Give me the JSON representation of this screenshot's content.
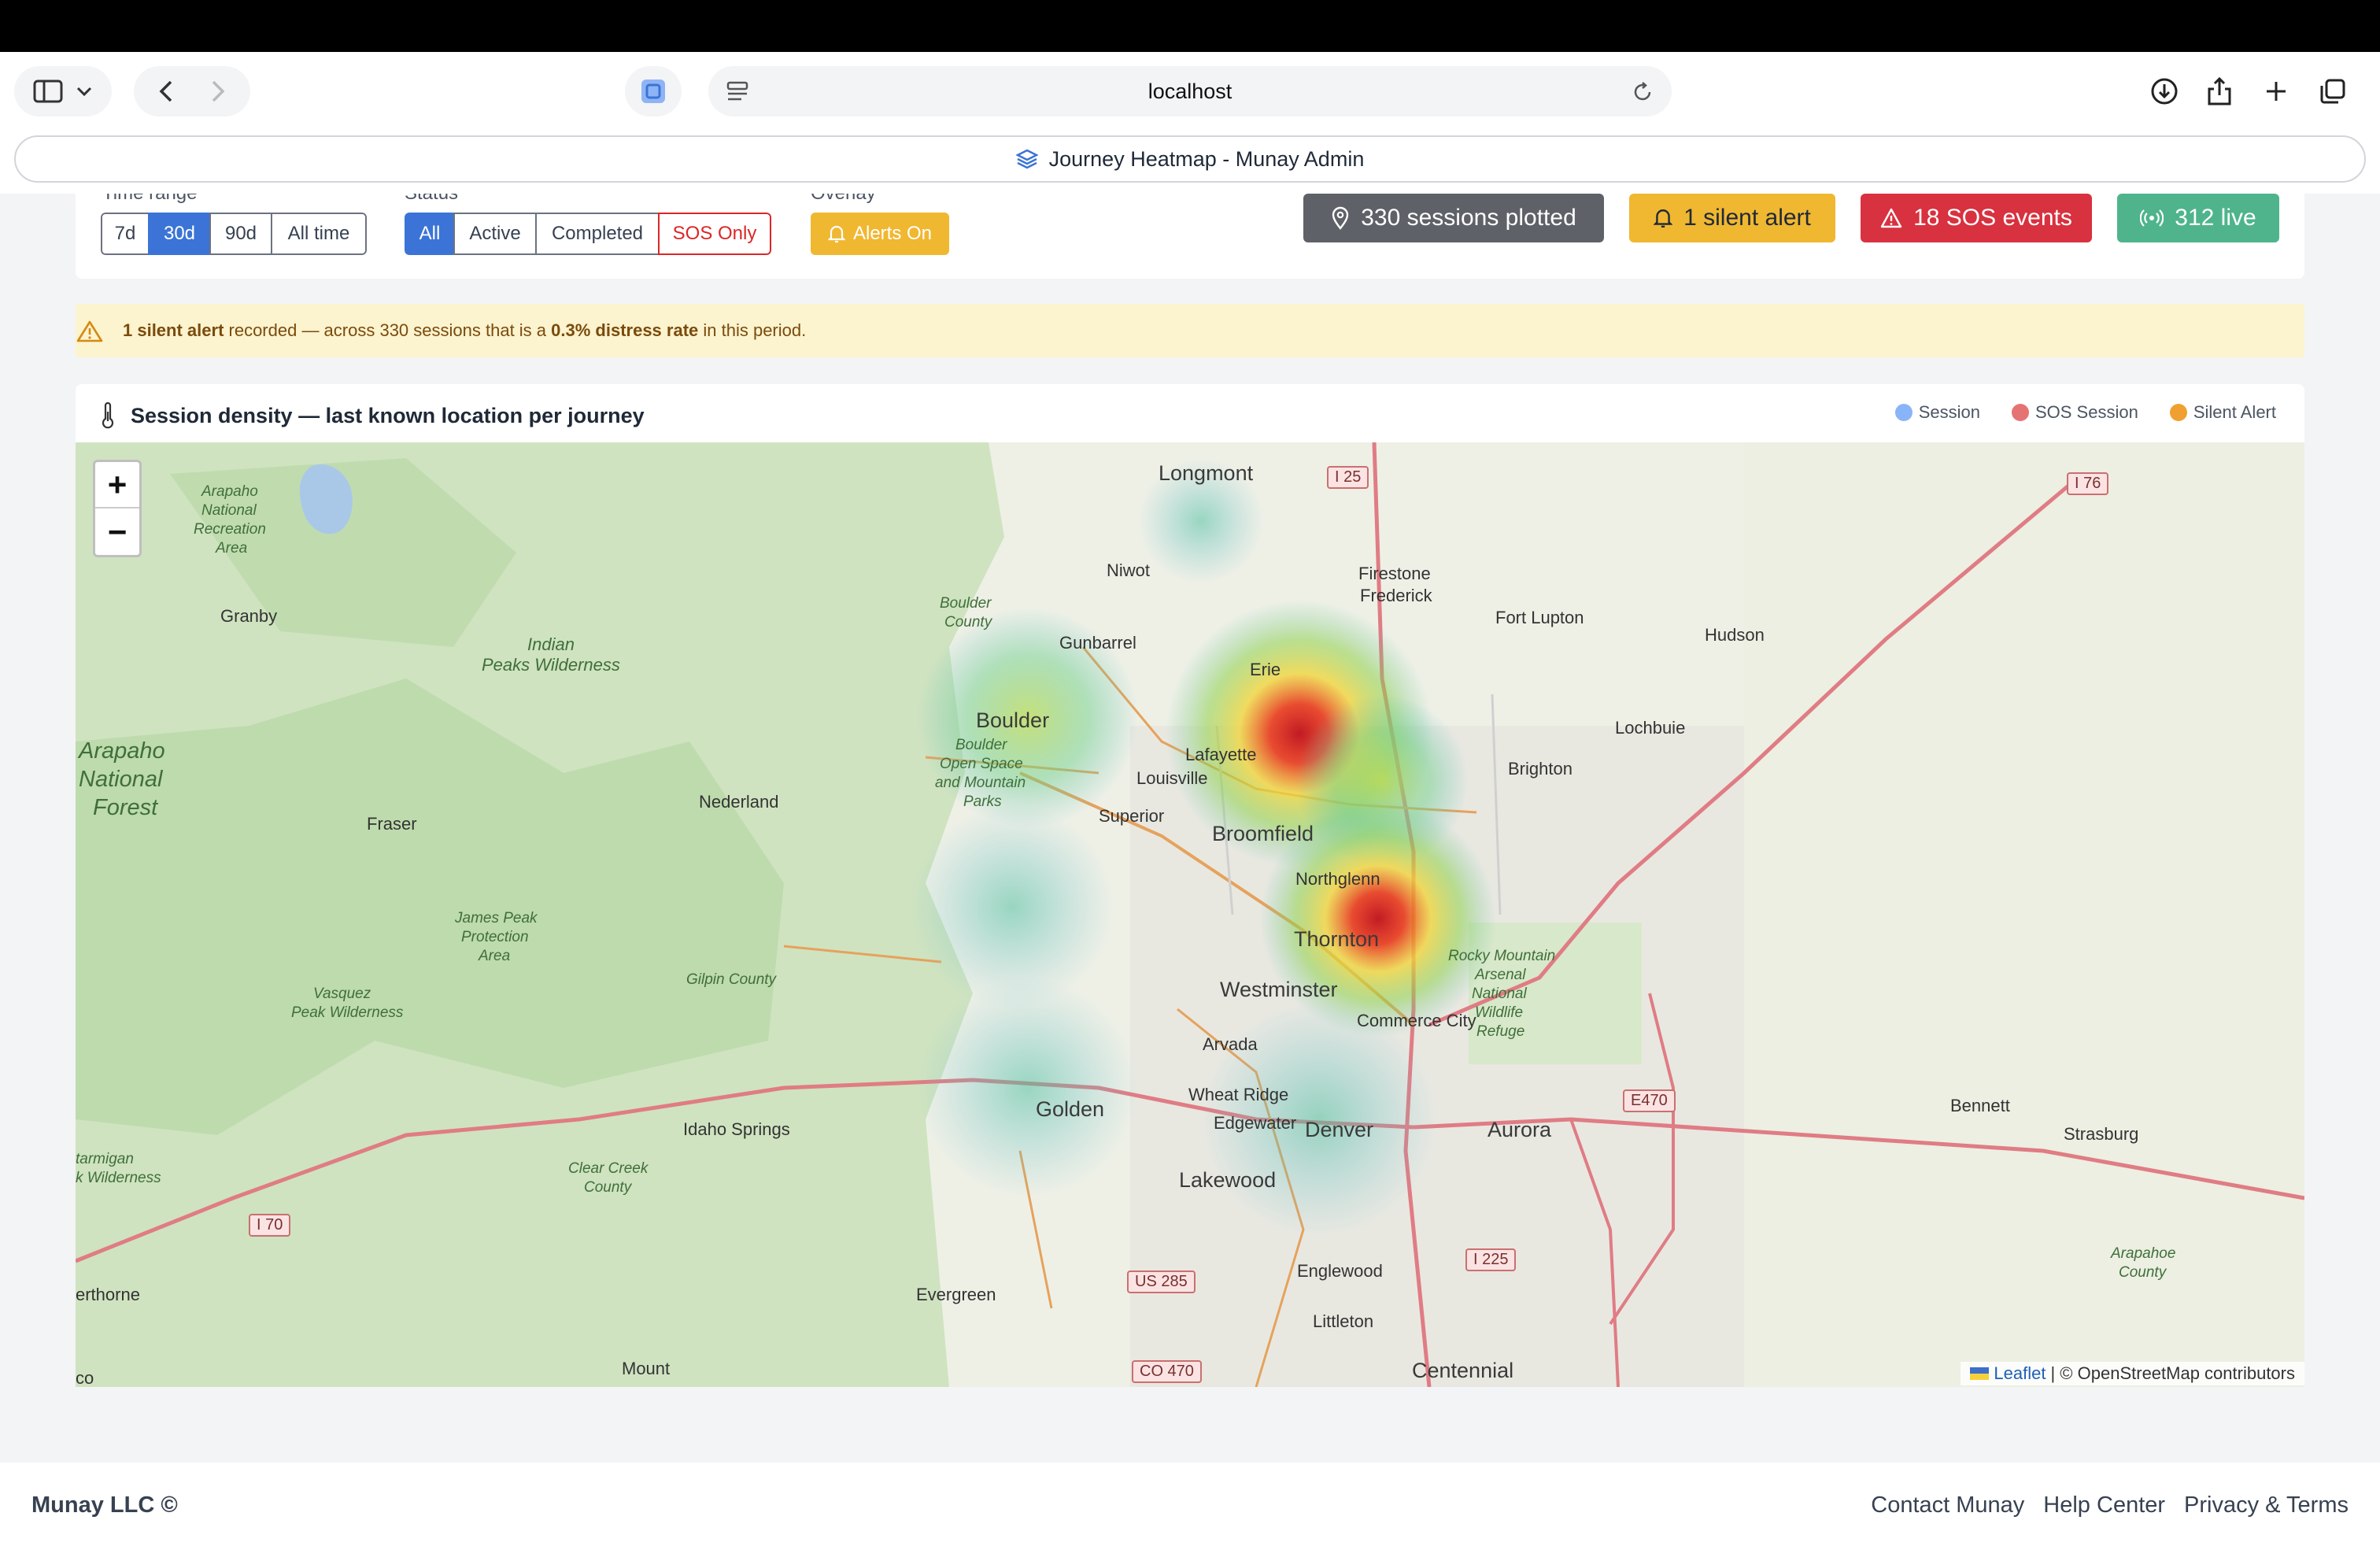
{
  "browser": {
    "url": "localhost",
    "tab_title": "Journey Heatmap - Munay Admin"
  },
  "filters": {
    "time_range": {
      "label": "Time range",
      "options": [
        "7d",
        "30d",
        "90d",
        "All time"
      ],
      "selected": "30d"
    },
    "status": {
      "label": "Status",
      "options": [
        "All",
        "Active",
        "Completed",
        "SOS Only"
      ],
      "selected": "All"
    },
    "overlay": {
      "label": "Overlay",
      "button": "Alerts On"
    }
  },
  "stats": {
    "sessions": "330 sessions plotted",
    "silent": "1 silent alert",
    "sos": "18 SOS events",
    "live": "312 live",
    "colors": {
      "sessions": "#5f6168",
      "silent": "#f0b731",
      "sos": "#d8313f",
      "live": "#4fb48c"
    }
  },
  "banner": {
    "strong1": "1 silent alert",
    "text1": " recorded — across 330 sessions that is a ",
    "strong2": "0.3% distress rate",
    "text2": " in this period."
  },
  "map_card": {
    "title": "Session density — last known location per journey",
    "legend": [
      {
        "label": "Session",
        "color": "#8ab4f8"
      },
      {
        "label": "SOS Session",
        "color": "#e57373"
      },
      {
        "label": "Silent Alert",
        "color": "#f0a030"
      }
    ],
    "zoom_in": "+",
    "zoom_out": "−",
    "attribution_link": "Leaflet",
    "attribution_text": "| © OpenStreetMap contributors",
    "places": {
      "longmont": "Longmont",
      "niwot": "Niwot",
      "firestone": "Firestone",
      "frederick": "Frederick",
      "fort_lupton": "Fort Lupton",
      "hudson": "Hudson",
      "gunbarrel": "Gunbarrel",
      "erie": "Erie",
      "boulder": "Boulder",
      "lafayette": "Lafayette",
      "louisville": "Louisville",
      "superior": "Superior",
      "broomfield": "Broomfield",
      "brighton": "Brighton",
      "lochbuie": "Lochbuie",
      "northglenn": "Northglenn",
      "thornton": "Thornton",
      "westminster": "Westminster",
      "commerce_city": "Commerce City",
      "arvada": "Arvada",
      "golden": "Golden",
      "wheat_ridge": "Wheat Ridge",
      "edgewater": "Edgewater",
      "denver": "Denver",
      "aurora": "Aurora",
      "lakewood": "Lakewood",
      "bennett": "Bennett",
      "strasburg": "Strasburg",
      "englewood": "Englewood",
      "littleton": "Littleton",
      "centennial": "Centennial",
      "evergreen": "Evergreen",
      "idaho_springs": "Idaho Springs",
      "granby": "Granby",
      "fraser": "Fraser",
      "nederland": "Nederland",
      "indian_peaks": "Indian Peaks Wilderness",
      "indian": "Indian",
      "peaks_wilderness": "Peaks Wilderness",
      "arapaho_nf_1": "Arapaho",
      "arapaho_nf_2": "National",
      "arapaho_nf_3": "Forest",
      "arapaho_nra_1": "Arapaho",
      "arapaho_nra_2": "National",
      "arapaho_nra_3": "Recreation",
      "arapaho_nra_4": "Area",
      "james_peak_1": "James Peak",
      "james_peak_2": "Protection",
      "james_peak_3": "Area",
      "vasquez_1": "Vasquez",
      "vasquez_2": "Peak Wilderness",
      "gilpin": "Gilpin County",
      "clear_creek_1": "Clear Creek",
      "clear_creek_2": "County",
      "boulder_county_1": "Boulder",
      "boulder_county_2": "County",
      "boulder_os_1": "Boulder",
      "boulder_os_2": "Open Space",
      "boulder_os_3": "and Mountain",
      "boulder_os_4": "Parks",
      "rma_1": "Rocky Mountain",
      "rma_2": "Arsenal",
      "rma_3": "National",
      "rma_4": "Wildlife",
      "rma_5": "Refuge",
      "arapahoe_county_1": "Arapahoe",
      "arapahoe_county_2": "County",
      "ptarmigan_1": "tarmigan",
      "ptarmigan_2": "k Wilderness",
      "erthorne": "erthorne",
      "mount": "Mount",
      "co": "co"
    },
    "shields": {
      "i25": "I 25",
      "i76": "I 76",
      "i70": "I 70",
      "i225": "I 225",
      "e470": "E470",
      "us285": "US 285",
      "co470": "CO 470"
    }
  },
  "footer": {
    "left": "Munay LLC ©",
    "links": [
      "Contact Munay",
      "Help Center",
      "Privacy & Terms"
    ]
  }
}
